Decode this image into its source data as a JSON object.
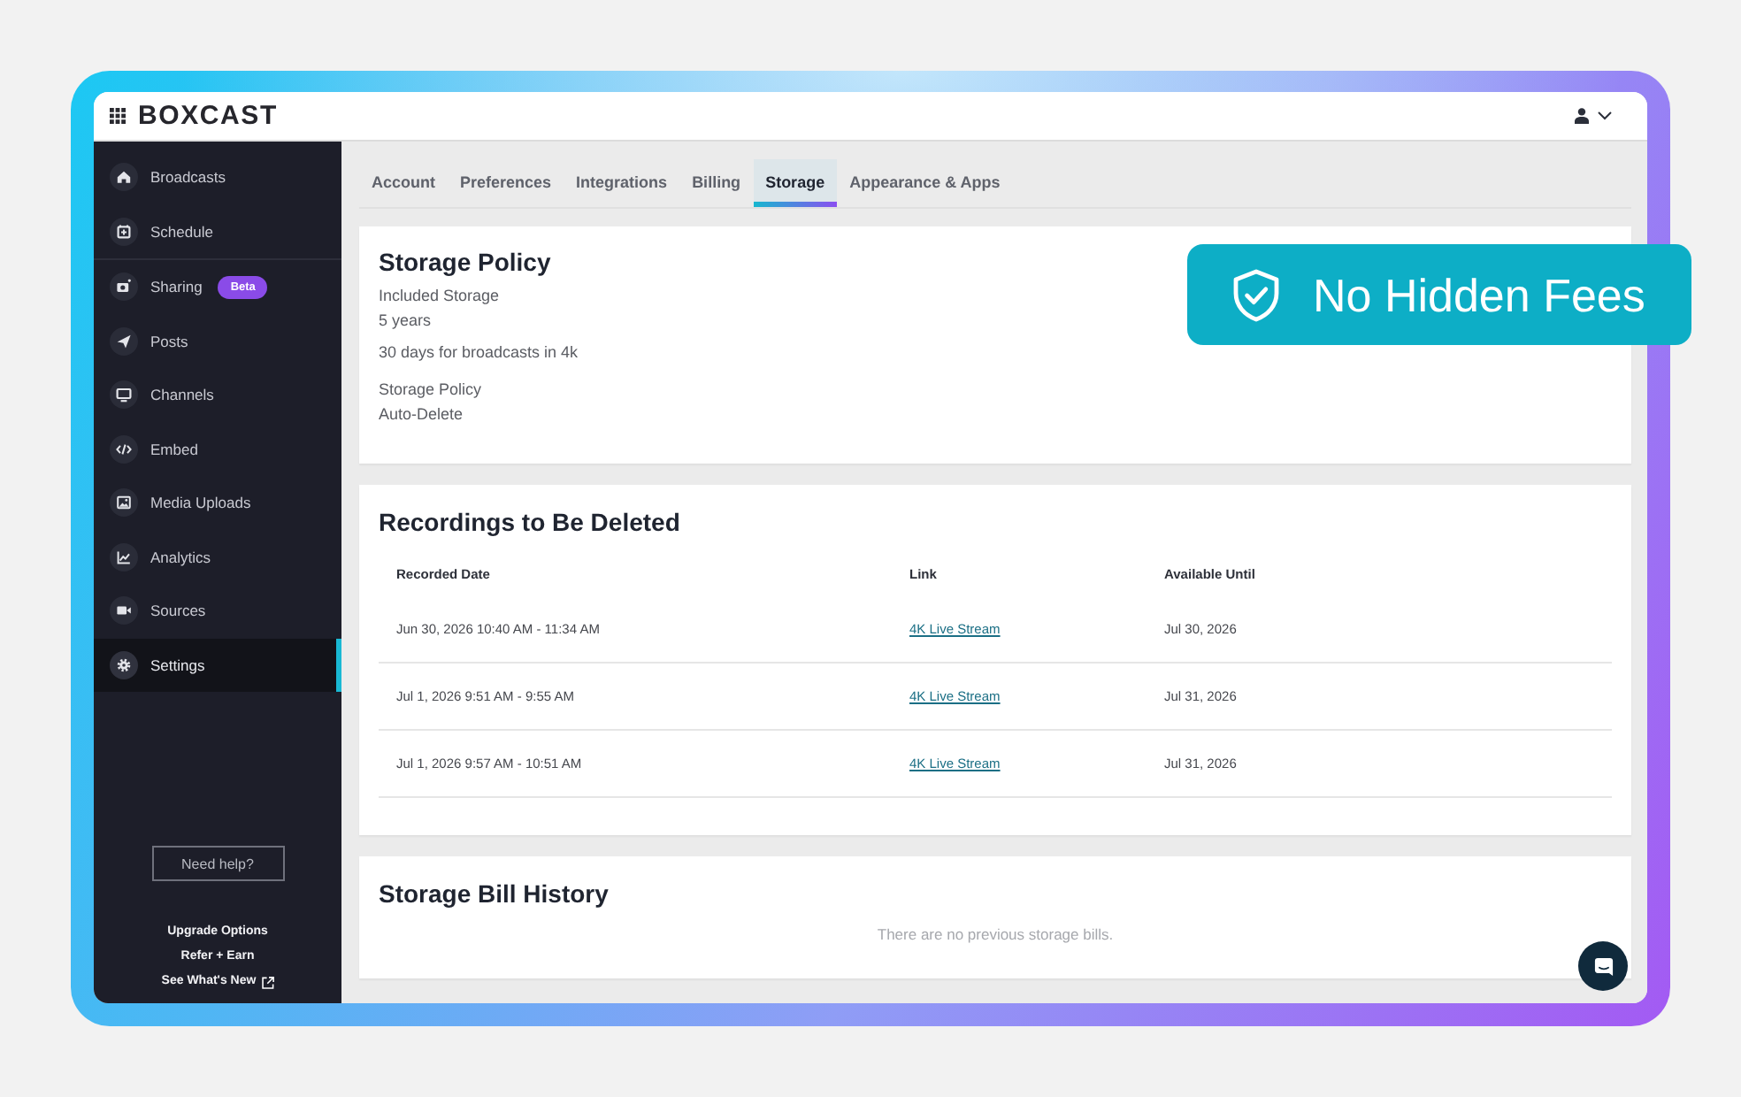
{
  "header": {
    "logo": "BOXCAST"
  },
  "sidebar": {
    "groups": [
      {
        "items": [
          {
            "label": "Broadcasts",
            "selected": false
          },
          {
            "label": "Schedule",
            "selected": false
          }
        ]
      },
      {
        "items": [
          {
            "label": "Sharing",
            "badge": "Beta",
            "selected": false
          },
          {
            "label": "Posts",
            "selected": false
          },
          {
            "label": "Channels",
            "selected": false
          },
          {
            "label": "Embed",
            "selected": false
          },
          {
            "label": "Media Uploads",
            "selected": false
          },
          {
            "label": "Analytics",
            "selected": false
          },
          {
            "label": "Sources",
            "selected": false
          },
          {
            "label": "Settings",
            "selected": true
          }
        ]
      }
    ],
    "help_button": "Need help?",
    "footer_links": [
      {
        "label": "Upgrade Options",
        "external": false
      },
      {
        "label": "Refer + Earn",
        "external": false
      },
      {
        "label": "See What's New",
        "external": true
      }
    ]
  },
  "tabs": [
    {
      "label": "Account",
      "selected": false
    },
    {
      "label": "Preferences",
      "selected": false
    },
    {
      "label": "Integrations",
      "selected": false
    },
    {
      "label": "Billing",
      "selected": false
    },
    {
      "label": "Storage",
      "selected": true
    },
    {
      "label": "Appearance & Apps",
      "selected": false
    }
  ],
  "storage_policy": {
    "title": "Storage Policy",
    "fields": [
      {
        "label": "Included Storage",
        "value": "5 years",
        "note": "30 days for broadcasts in 4k"
      },
      {
        "label": "Storage Policy",
        "value": "Auto-Delete"
      }
    ]
  },
  "recordings": {
    "title": "Recordings to Be Deleted",
    "columns": [
      "Recorded Date",
      "Link",
      "Available Until"
    ],
    "rows": [
      {
        "recorded_date": "Jun 30, 2026 10:40 AM - 11:34 AM",
        "link": "4K Live Stream",
        "available_until": "Jul 30, 2026"
      },
      {
        "recorded_date": "Jul 1, 2026 9:51 AM - 9:55 AM",
        "link": "4K Live Stream",
        "available_until": "Jul 31, 2026"
      },
      {
        "recorded_date": "Jul 1, 2026 9:57 AM - 10:51 AM",
        "link": "4K Live Stream",
        "available_until": "Jul 31, 2026"
      }
    ]
  },
  "bill_history": {
    "title": "Storage Bill History",
    "empty_message": "There are no previous storage bills."
  },
  "promo": {
    "text": "No Hidden Fees"
  }
}
